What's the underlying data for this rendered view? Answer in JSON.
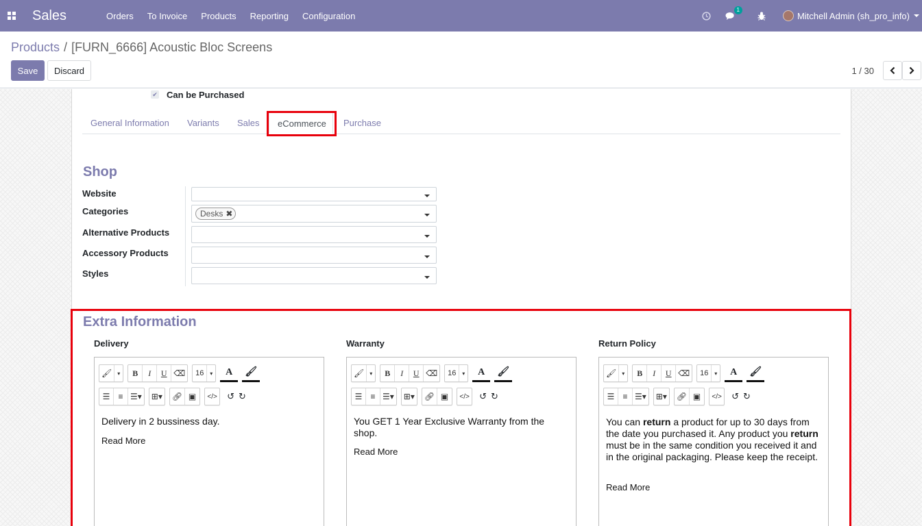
{
  "navbar": {
    "app_name": "Sales",
    "menu": [
      "Orders",
      "To Invoice",
      "Products",
      "Reporting",
      "Configuration"
    ],
    "messages_badge": "1",
    "user": "Mitchell Admin (sh_pro_info)",
    "color": "#7c7bad"
  },
  "control_panel": {
    "breadcrumb_parent": "Products",
    "breadcrumb_sep": "/",
    "breadcrumb_current": "[FURN_6666] Acoustic Bloc Screens",
    "save_label": "Save",
    "discard_label": "Discard",
    "pager": "1 / 30"
  },
  "form": {
    "can_be_purchased": "Can be Purchased",
    "tabs": [
      "General Information",
      "Variants",
      "Sales",
      "eCommerce",
      "Purchase"
    ],
    "active_tab": "eCommerce",
    "shop": {
      "title": "Shop",
      "website_label": "Website",
      "categories_label": "Categories",
      "category_tag": "Desks",
      "alternative_label": "Alternative Products",
      "accessory_label": "Accessory Products",
      "styles_label": "Styles"
    },
    "extra": {
      "title": "Extra Information",
      "delivery_label": "Delivery",
      "warranty_label": "Warranty",
      "return_label": "Return Policy",
      "delivery_text": "Delivery in 2 bussiness day.",
      "warranty_text": "You GET 1 Year Exclusive Warranty from the shop.",
      "return_text_1": "You can ",
      "return_bold_1": "return",
      "return_text_2": " a product for up to 30 days from the date you purchased it. Any product you ",
      "return_bold_2": "return",
      "return_text_3": " must be in the same condition you received it and in the original packaging. Please keep the receipt.",
      "read_more": "Read More",
      "font_size": "16"
    }
  },
  "highlight_color": "#e8000b"
}
